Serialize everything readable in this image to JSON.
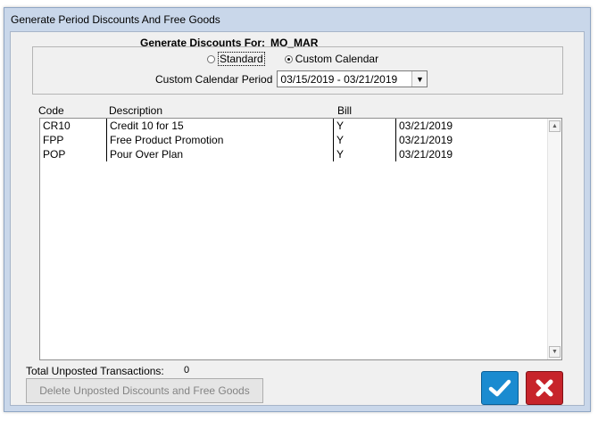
{
  "window": {
    "title": "Generate Period Discounts And Free Goods"
  },
  "heading": {
    "label": "Generate Discounts For:",
    "value": "MO_MAR"
  },
  "calendar": {
    "standard_label": "Standard",
    "custom_label": "Custom Calendar",
    "selected": "custom",
    "period_label": "Custom Calendar Period",
    "period_value": "03/15/2019 - 03/21/2019"
  },
  "table": {
    "headers": [
      "Code",
      "Description",
      "Bill"
    ],
    "rows": [
      {
        "code": "CR10",
        "description": "Credit 10 for 15",
        "bill": "Y",
        "date": "03/21/2019"
      },
      {
        "code": "FPP",
        "description": "Free Product Promotion",
        "bill": "Y",
        "date": "03/21/2019"
      },
      {
        "code": "POP",
        "description": "Pour Over Plan",
        "bill": "Y",
        "date": "03/21/2019"
      }
    ]
  },
  "footer": {
    "total_label": "Total Unposted Transactions:",
    "total_value": "0",
    "delete_label": "Delete Unposted Discounts and Free Goods"
  },
  "icons": {
    "ok": "checkmark-icon",
    "cancel": "close-icon"
  },
  "colors": {
    "ok": "#1b8bd0",
    "cancel": "#c7242b",
    "titlebar": "#c9d7ea"
  }
}
